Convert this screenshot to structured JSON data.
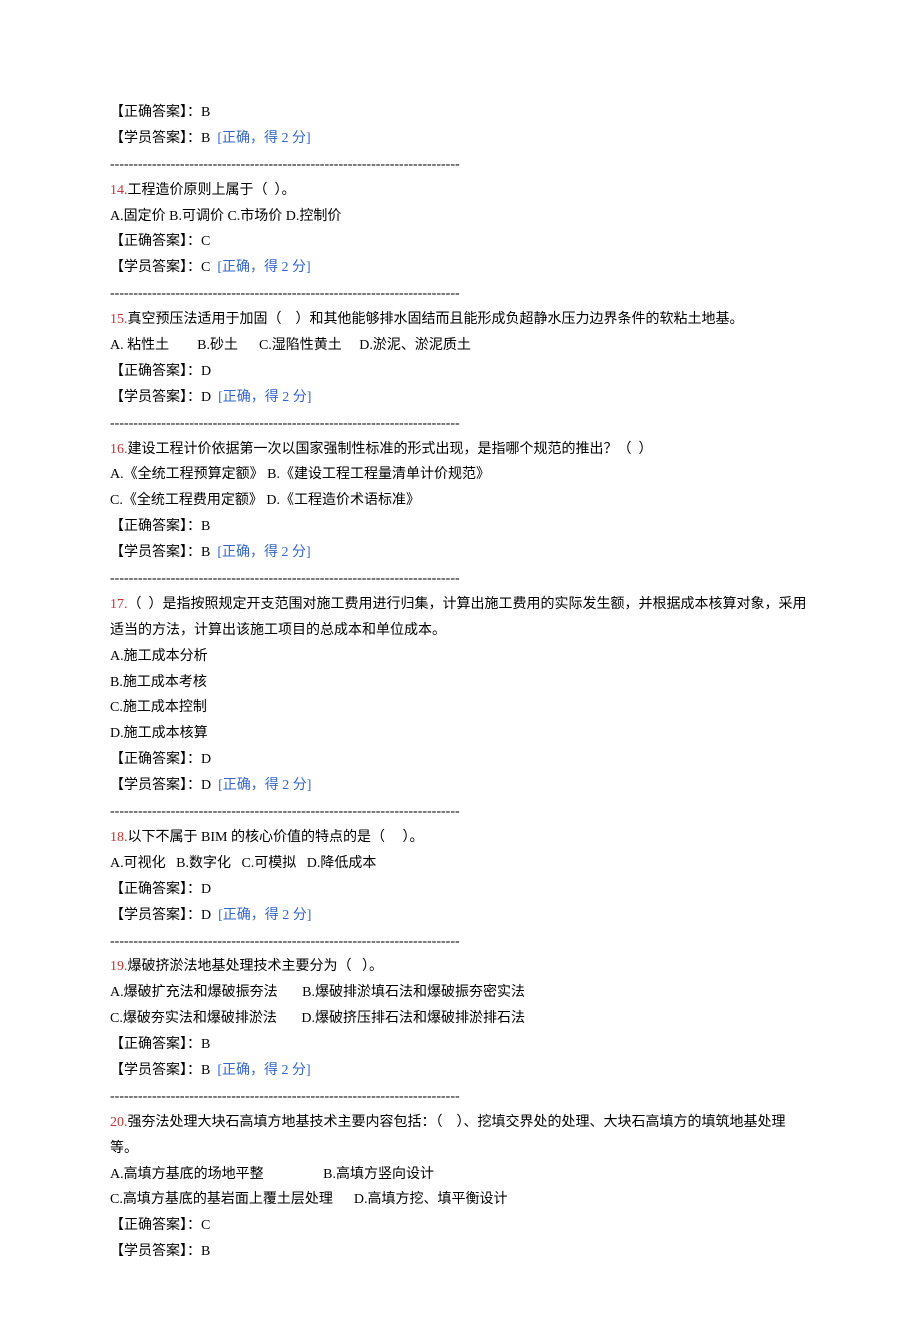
{
  "q13": {
    "correct_label": "【正确答案】：",
    "correct_val": "B",
    "student_label": "【学员答案】：",
    "student_val": "B  ",
    "score": "[正确，得 2 分]"
  },
  "q14": {
    "no": "14.",
    "text": "工程造价原则上属于（  ）。",
    "opts": "A.固定价 B.可调价 C.市场价 D.控制价",
    "correct_label": "【正确答案】：",
    "correct_val": "C",
    "student_label": "【学员答案】：",
    "student_val": "C  ",
    "score": "[正确，得 2 分]"
  },
  "q15": {
    "no": "15.",
    "text": "真空预压法适用于加固（    ）和其他能够排水固结而且能形成负超静水压力边界条件的软粘土地基。",
    "opts": "A. 粘性土        B.砂土      C.湿陷性黄土     D.淤泥、淤泥质土",
    "correct_label": "【正确答案】：",
    "correct_val": "D",
    "student_label": "【学员答案】：",
    "student_val": "D  ",
    "score": "[正确，得 2 分]"
  },
  "q16": {
    "no": "16.",
    "text": "建设工程计价依据第一次以国家强制性标准的形式出现，是指哪个规范的推出？（  ）",
    "opts1": "A.《全统工程预算定额》 B.《建设工程工程量清单计价规范》",
    "opts2": "C.《全统工程费用定额》 D.《工程造价术语标准》",
    "correct_label": "【正确答案】：",
    "correct_val": "B",
    "student_label": "【学员答案】：",
    "student_val": "B  ",
    "score": "[正确，得 2 分]"
  },
  "q17": {
    "no": "17.",
    "text": "（  ）是指按照规定开支范围对施工费用进行归集，计算出施工费用的实际发生额，并根据成本核算对象，采用适当的方法，计算出该施工项目的总成本和单位成本。",
    "optA": "A.施工成本分析",
    "optB": "B.施工成本考核",
    "optC": "C.施工成本控制",
    "optD": "D.施工成本核算",
    "correct_label": "【正确答案】：",
    "correct_val": "D",
    "student_label": "【学员答案】：",
    "student_val": "D  ",
    "score": "[正确，得 2 分]"
  },
  "q18": {
    "no": "18.",
    "text": "以下不属于 BIM 的核心价值的特点的是（     ）。",
    "opts": "A.可视化   B.数字化   C.可模拟   D.降低成本",
    "correct_label": "【正确答案】：",
    "correct_val": "D",
    "student_label": "【学员答案】：",
    "student_val": "D  ",
    "score": "[正确，得 2 分]"
  },
  "q19": {
    "no": "19.",
    "text": "爆破挤淤法地基处理技术主要分为（   ）。",
    "opts1": "A.爆破扩充法和爆破振夯法       B.爆破排淤填石法和爆破振夯密实法",
    "opts2": "C.爆破夯实法和爆破排淤法       D.爆破挤压排石法和爆破排淤排石法",
    "correct_label": "【正确答案】：",
    "correct_val": "B",
    "student_label": "【学员答案】：",
    "student_val": "B  ",
    "score": "[正确，得 2 分]"
  },
  "q20": {
    "no": "20.",
    "text": "强夯法处理大块石高填方地基技术主要内容包括：（    ）、挖填交界处的处理、大块石高填方的填筑地基处理等。",
    "opts1": "A.高填方基底的场地平整                 B.高填方竖向设计",
    "opts2": "C.高填方基底的基岩面上覆土层处理      D.高填方挖、填平衡设计",
    "correct_label": "【正确答案】：",
    "correct_val": "C",
    "student_label": "【学员答案】：",
    "student_val": "B"
  },
  "divider": "---------------------------------------------------------------------------"
}
